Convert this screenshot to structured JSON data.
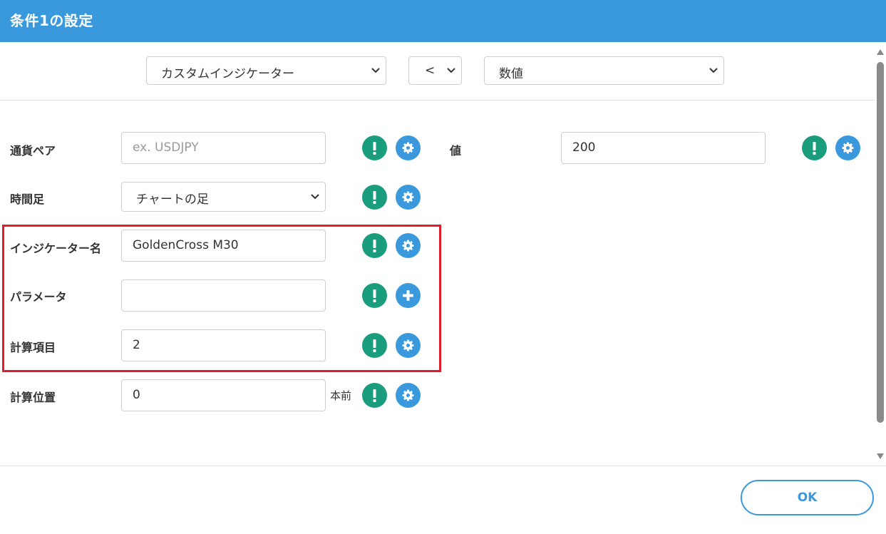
{
  "header": {
    "title": "条件1の設定"
  },
  "top": {
    "indicator_select": "カスタムインジケーター",
    "operator_select": "<",
    "value_type_select": "数値"
  },
  "left_fields": [
    {
      "label": "通貨ペア",
      "value": "",
      "placeholder": "ex. USDJPY"
    },
    {
      "label": "時間足",
      "value": "チャートの足"
    },
    {
      "label": "インジケーター名",
      "value": "GoldenCross M30"
    },
    {
      "label": "パラメータ",
      "value": ""
    },
    {
      "label": "計算項目",
      "value": "2"
    },
    {
      "label": "計算位置",
      "value": "0",
      "suffix": "本前"
    }
  ],
  "right_fields": [
    {
      "label": "値",
      "value": "200"
    }
  ],
  "footer": {
    "ok_label": "OK"
  },
  "colors": {
    "header": "#3a98dc",
    "info_button": "#1a9d7c",
    "settings_button": "#3a98dc",
    "highlight_border": "#e21c2a"
  },
  "icons": {
    "info": "exclamation-icon",
    "settings": "gear-icon",
    "add": "plus-icon"
  }
}
